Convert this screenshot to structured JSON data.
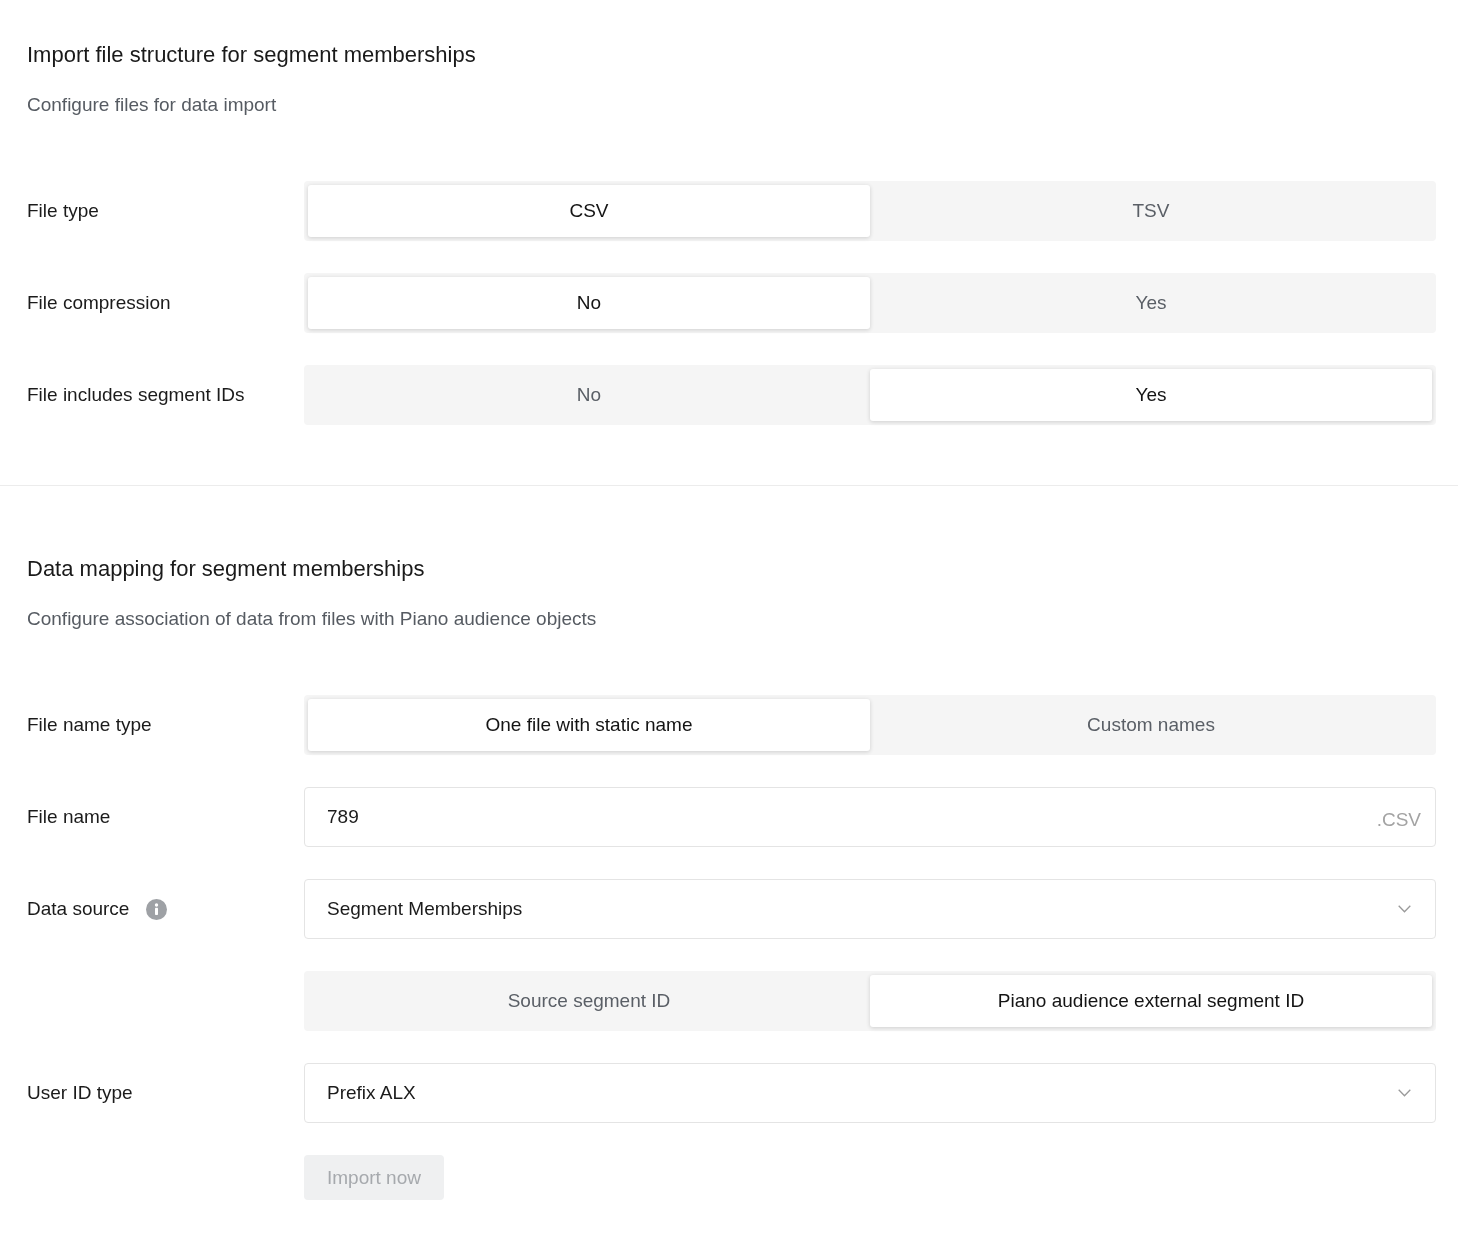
{
  "sections": [
    {
      "title": "Import file structure for segment memberships",
      "subtitle": "Configure files for data import",
      "rows": [
        {
          "kind": "segmented",
          "label": "File type",
          "options": [
            {
              "label": "CSV",
              "selected": true
            },
            {
              "label": "TSV",
              "selected": false
            }
          ]
        },
        {
          "kind": "segmented",
          "label": "File compression",
          "options": [
            {
              "label": "No",
              "selected": true
            },
            {
              "label": "Yes",
              "selected": false
            }
          ]
        },
        {
          "kind": "segmented",
          "label": "File includes segment IDs",
          "options": [
            {
              "label": "No",
              "selected": false
            },
            {
              "label": "Yes",
              "selected": true
            }
          ]
        }
      ]
    },
    {
      "title": "Data mapping for segment memberships",
      "subtitle": "Configure association of data from files with Piano audience objects",
      "rows": [
        {
          "kind": "segmented",
          "label": "File name type",
          "options": [
            {
              "label": "One file with static name",
              "selected": true
            },
            {
              "label": "Custom names",
              "selected": false
            }
          ]
        },
        {
          "kind": "input",
          "label": "File name",
          "value": "789",
          "suffix": ".CSV"
        },
        {
          "kind": "select",
          "label": "Data source",
          "has_tooltip": true,
          "value": "Segment Memberships"
        },
        {
          "kind": "segmented",
          "options": [
            {
              "label": "Source segment ID",
              "selected": false
            },
            {
              "label": "Piano audience external segment ID",
              "selected": true
            }
          ]
        },
        {
          "kind": "select",
          "label": "User ID type",
          "value": "Prefix ALX"
        },
        {
          "kind": "button",
          "text": "Import now",
          "disabled": true
        }
      ]
    }
  ]
}
